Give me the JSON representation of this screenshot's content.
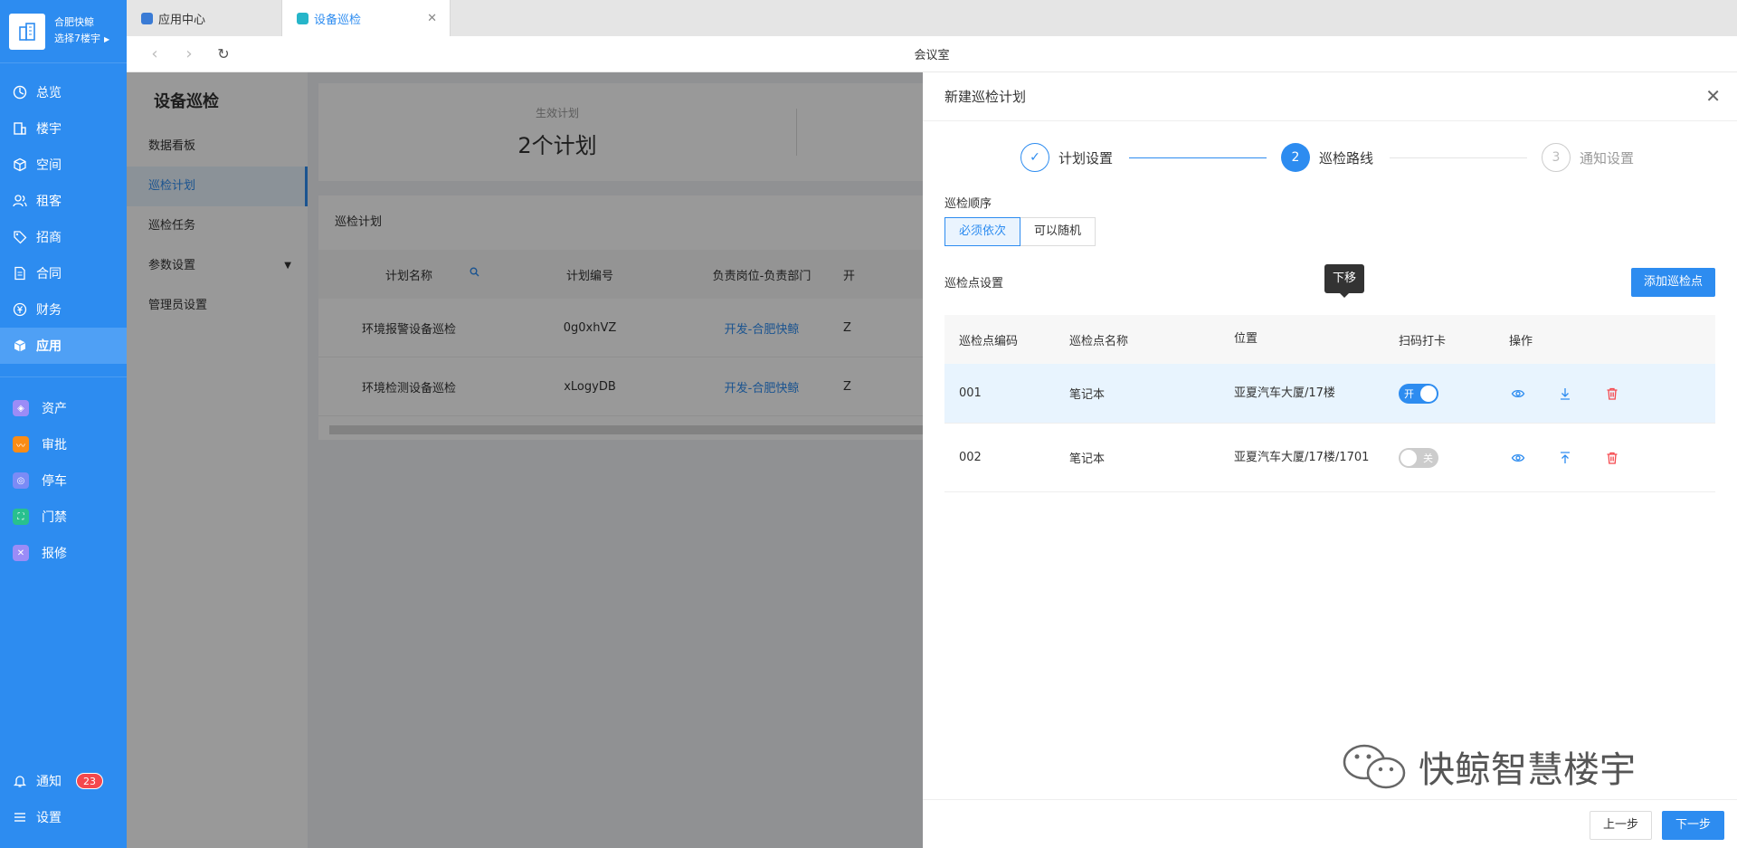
{
  "brand": {
    "name": "合肥快鲸",
    "building": "选择7楼宇"
  },
  "nav": {
    "main": [
      {
        "label": "总览"
      },
      {
        "label": "楼宇"
      },
      {
        "label": "空间"
      },
      {
        "label": "租客"
      },
      {
        "label": "招商"
      },
      {
        "label": "合同"
      },
      {
        "label": "财务"
      },
      {
        "label": "应用"
      }
    ],
    "apps": [
      {
        "label": "资产",
        "color": "#9b8cf7"
      },
      {
        "label": "审批",
        "color": "#fa8c16"
      },
      {
        "label": "停车",
        "color": "#7b8bf6"
      },
      {
        "label": "门禁",
        "color": "#28c08e"
      },
      {
        "label": "报修",
        "color": "#9b8cf7"
      }
    ],
    "notify_label": "通知",
    "notify_count": "23",
    "settings_label": "设置"
  },
  "tabs": [
    {
      "label": "应用中心"
    },
    {
      "label": "设备巡检"
    }
  ],
  "page_title": "会议室",
  "module": {
    "title": "设备巡检",
    "items": [
      {
        "label": "数据看板"
      },
      {
        "label": "巡检计划"
      },
      {
        "label": "巡检任务"
      },
      {
        "label": "参数设置"
      },
      {
        "label": "管理员设置"
      }
    ]
  },
  "stats": {
    "label": "生效计划",
    "value": "2个计划"
  },
  "plans": {
    "title": "巡检计划",
    "headers": [
      "计划名称",
      "计划编号",
      "负责岗位-负责部门",
      "开"
    ],
    "rows": [
      {
        "name": "环境报警设备巡检",
        "code": "0g0xhVZ",
        "dept": "开发-合肥快鲸",
        "more": "Z"
      },
      {
        "name": "环境检测设备巡检",
        "code": "xLogyDB",
        "dept": "开发-合肥快鲸",
        "more": "Z"
      }
    ]
  },
  "drawer": {
    "title": "新建巡检计划",
    "steps": [
      {
        "label": "计划设置",
        "num": "✓"
      },
      {
        "label": "巡检路线",
        "num": "2"
      },
      {
        "label": "通知设置",
        "num": "3"
      }
    ],
    "order_label": "巡检顺序",
    "order_options": [
      "必须依次",
      "可以随机"
    ],
    "points_label": "巡检点设置",
    "add_button": "添加巡检点",
    "table_headers": [
      "巡检点编码",
      "巡检点名称",
      "位置",
      "扫码打卡",
      "操作"
    ],
    "rows": [
      {
        "code": "001",
        "name": "笔记本",
        "location": "亚夏汽车大厦/17楼",
        "toggle_text": "开"
      },
      {
        "code": "002",
        "name": "笔记本",
        "location": "亚夏汽车大厦/17楼/1701",
        "toggle_text": "关"
      }
    ],
    "tooltip": "下移",
    "prev_button": "上一步",
    "next_button": "下一步"
  },
  "watermark": "快鲸智慧楼宇",
  "colors": {
    "primary": "#2d8cf0",
    "danger": "#f5484d"
  }
}
